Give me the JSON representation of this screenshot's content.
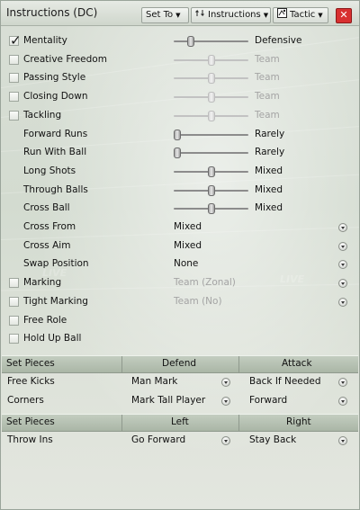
{
  "window": {
    "title": "Instructions (DC)"
  },
  "toolbar": {
    "set_to": "Set To",
    "instructions": "Instructions",
    "tactic": "Tactic",
    "close": "✕"
  },
  "background": {
    "overlay_text": "LIVE"
  },
  "instructions": [
    {
      "label": "Mentality",
      "checked": true,
      "dim": false,
      "control": "slider",
      "level": 0.2,
      "value": "Defensive"
    },
    {
      "label": "Creative Freedom",
      "checked": false,
      "dim": true,
      "control": "slider",
      "level": 0.5,
      "value": "Team"
    },
    {
      "label": "Passing Style",
      "checked": false,
      "dim": true,
      "control": "slider",
      "level": 0.5,
      "value": "Team"
    },
    {
      "label": "Closing Down",
      "checked": false,
      "dim": true,
      "control": "slider",
      "level": 0.5,
      "value": "Team"
    },
    {
      "label": "Tackling",
      "checked": false,
      "dim": true,
      "control": "slider",
      "level": 0.5,
      "value": "Team"
    },
    {
      "label": "Forward Runs",
      "checked": null,
      "dim": false,
      "control": "slider",
      "level": 0.0,
      "value": "Rarely"
    },
    {
      "label": "Run With Ball",
      "checked": null,
      "dim": false,
      "control": "slider",
      "level": 0.0,
      "value": "Rarely"
    },
    {
      "label": "Long Shots",
      "checked": null,
      "dim": false,
      "control": "slider",
      "level": 0.5,
      "value": "Mixed"
    },
    {
      "label": "Through Balls",
      "checked": null,
      "dim": false,
      "control": "slider",
      "level": 0.5,
      "value": "Mixed"
    },
    {
      "label": "Cross Ball",
      "checked": null,
      "dim": false,
      "control": "slider",
      "level": 0.5,
      "value": "Mixed"
    },
    {
      "label": "Cross From",
      "checked": null,
      "dim": false,
      "control": "dropdown",
      "value": "Mixed"
    },
    {
      "label": "Cross Aim",
      "checked": null,
      "dim": false,
      "control": "dropdown",
      "value": "Mixed"
    },
    {
      "label": "Swap Position",
      "checked": null,
      "dim": false,
      "control": "dropdown",
      "value": "None"
    },
    {
      "label": "Marking",
      "checked": false,
      "dim": true,
      "control": "dropdown",
      "value": "Team (Zonal)"
    },
    {
      "label": "Tight Marking",
      "checked": false,
      "dim": true,
      "control": "dropdown",
      "value": "Team (No)"
    },
    {
      "label": "Free Role",
      "checked": false,
      "dim": false,
      "control": "none",
      "value": ""
    },
    {
      "label": "Hold Up Ball",
      "checked": false,
      "dim": false,
      "control": "none",
      "value": ""
    }
  ],
  "set_pieces": {
    "header1": {
      "col1": "Set Pieces",
      "col2": "Defend",
      "col3": "Attack"
    },
    "rows1": [
      {
        "label": "Free Kicks",
        "defend": "Man Mark",
        "attack": "Back If Needed"
      },
      {
        "label": "Corners",
        "defend": "Mark Tall Player",
        "attack": "Forward"
      }
    ],
    "header2": {
      "col1": "Set Pieces",
      "col2": "Left",
      "col3": "Right"
    },
    "rows2": [
      {
        "label": "Throw Ins",
        "defend": "Go Forward",
        "attack": "Stay Back"
      }
    ]
  },
  "colors": {
    "close_red": "#d83030",
    "header_green": "#b4c0b0"
  }
}
